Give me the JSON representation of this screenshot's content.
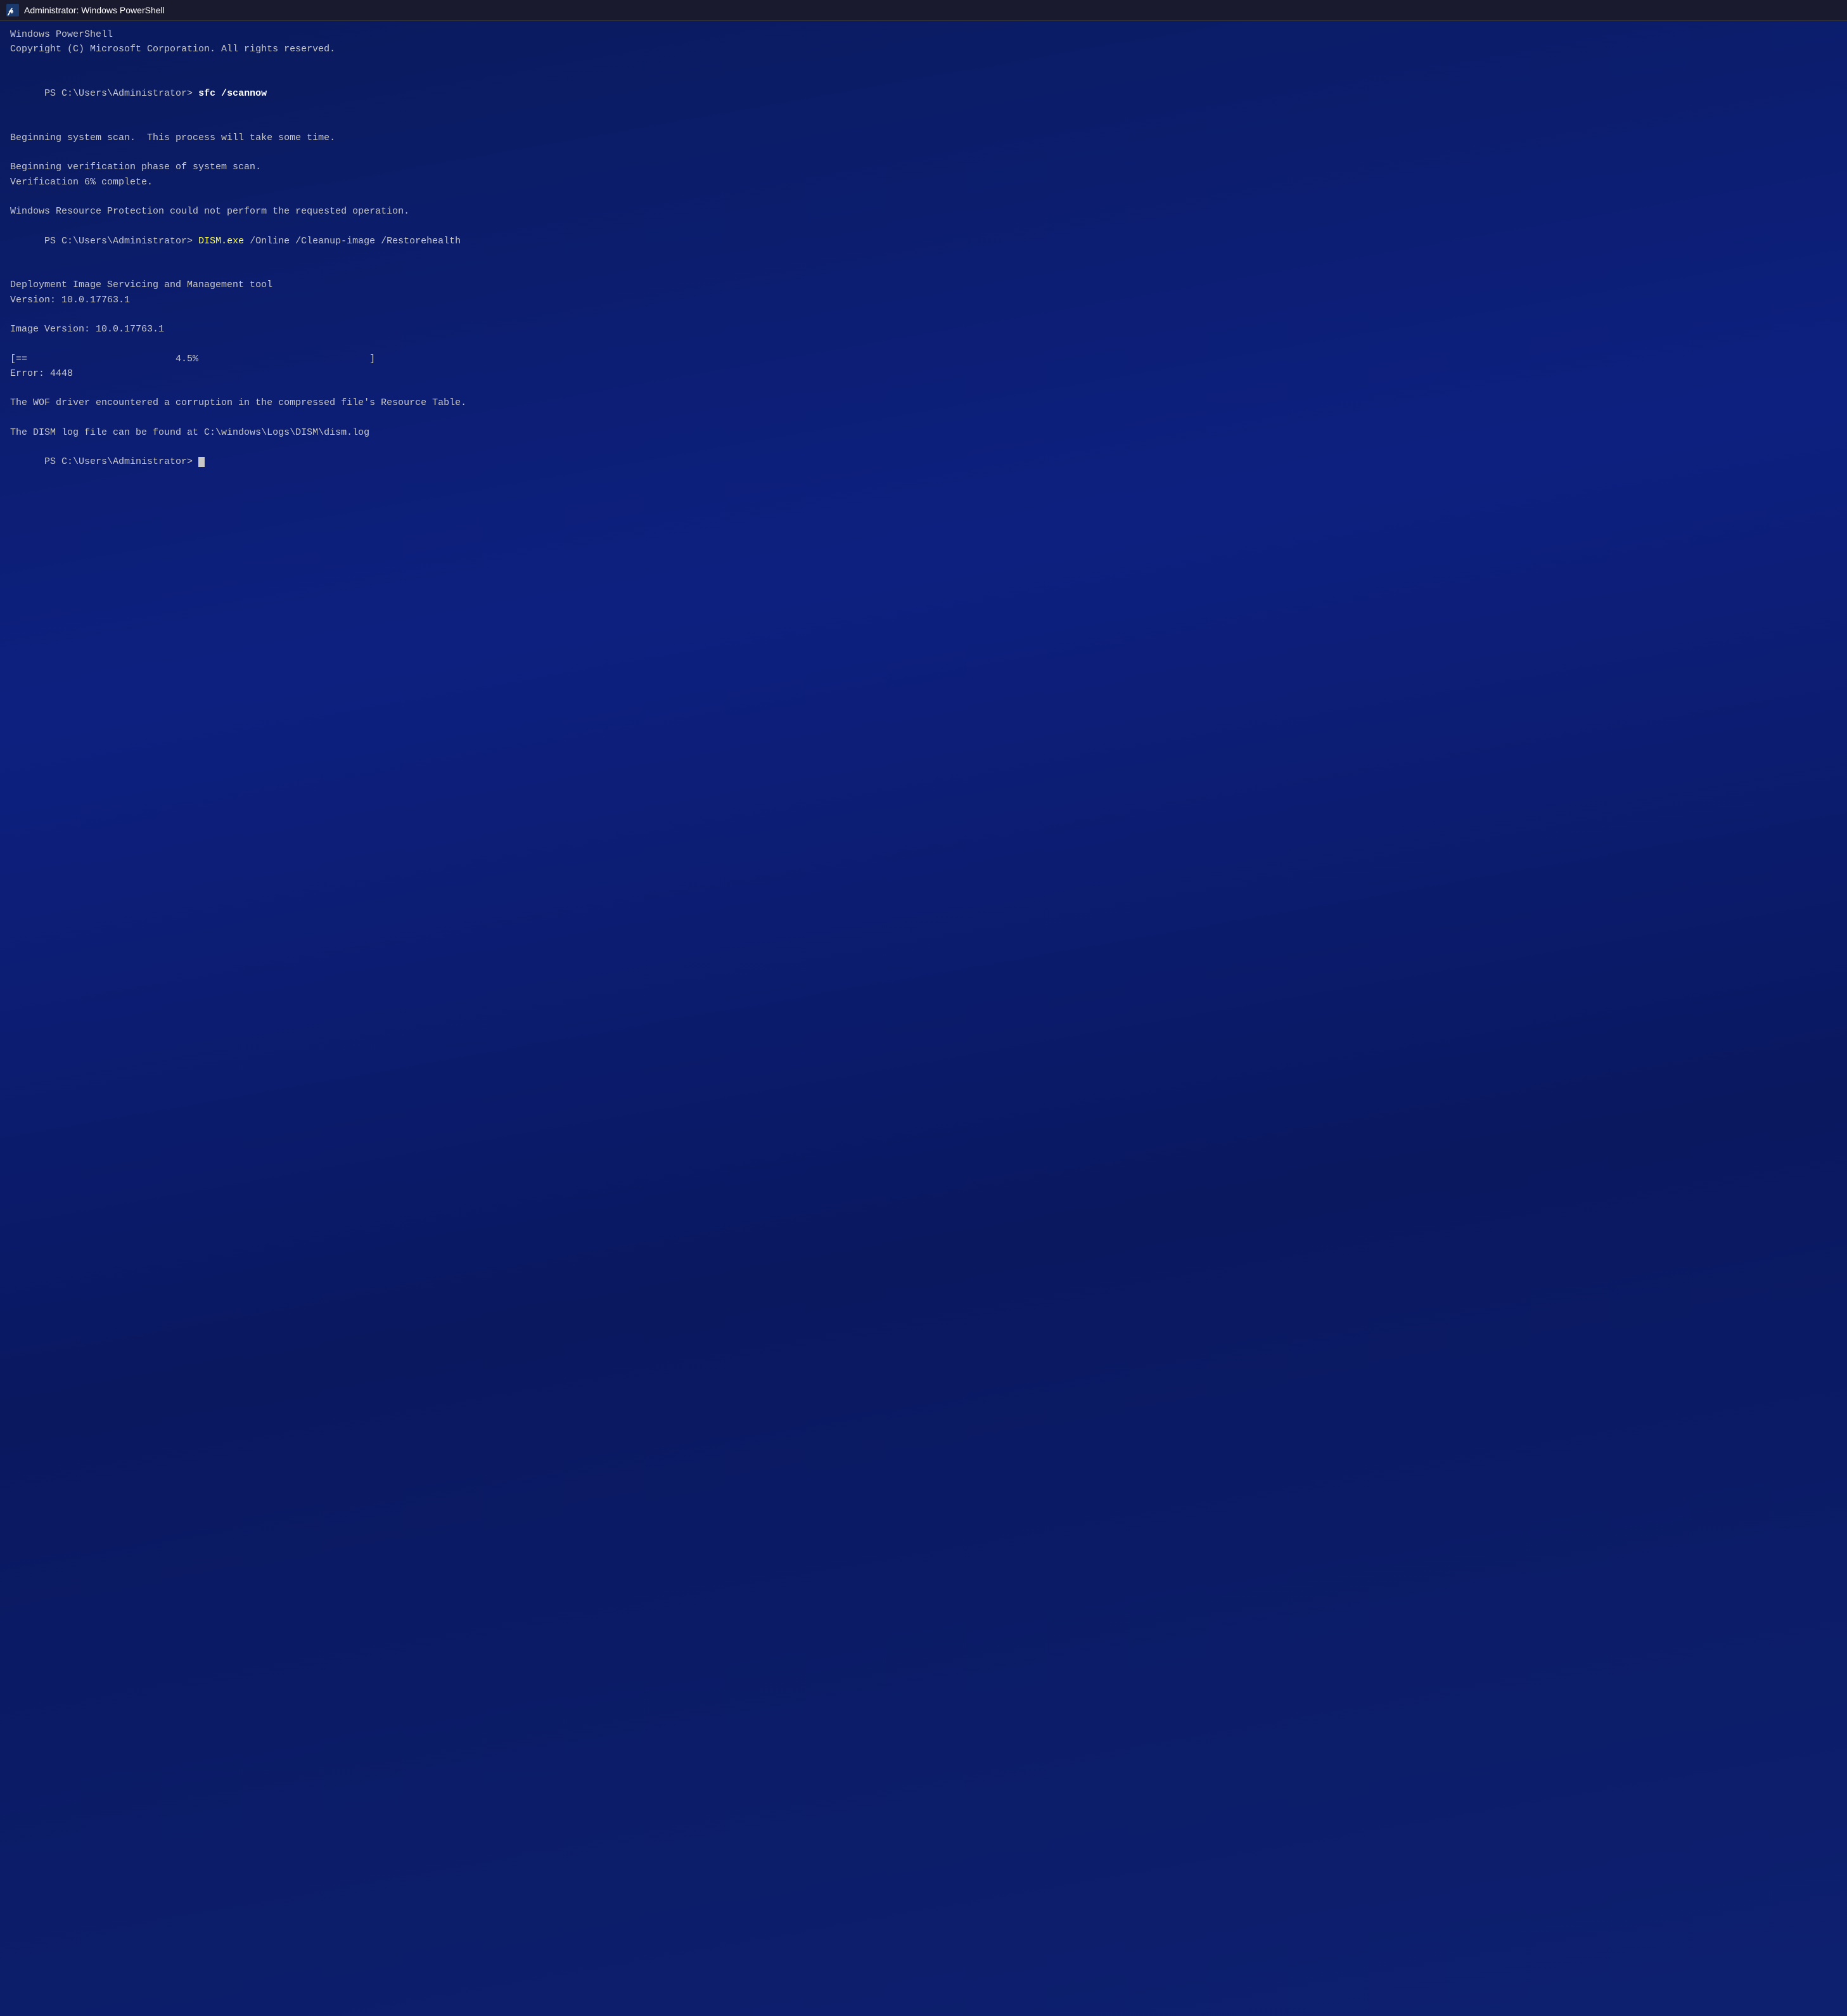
{
  "titlebar": {
    "icon": "powershell-icon",
    "title": "Administrator: Windows PowerShell"
  },
  "terminal": {
    "header_line1": "Windows PowerShell",
    "header_line2": "Copyright (C) Microsoft Corporation. All rights reserved.",
    "prompt1": "PS C:\\Users\\Administrator> ",
    "command1": "sfc /scannow",
    "blank1": "",
    "line1": "Beginning system scan.  This process will take some time.",
    "blank2": "",
    "line2": "Beginning verification phase of system scan.",
    "line3": "Verification 6% complete.",
    "blank3": "",
    "line4": "Windows Resource Protection could not perform the requested operation.",
    "prompt2_before": "PS C:\\Users\\Administrator> ",
    "dism_exe": "DISM.exe",
    "dism_args": " /Online /Cleanup-image /Restorehealth",
    "blank4": "",
    "dism_line1": "Deployment Image Servicing and Management tool",
    "dism_line2": "Version: 10.0.17763.1",
    "blank5": "",
    "image_version": "Image Version: 10.0.17763.1",
    "blank6": "",
    "progress_line": "[==                          4.5%                              ]",
    "error_line": "Error: 4448",
    "blank7": "",
    "wof_error": "The WOF driver encountered a corruption in the compressed file's Resource Table.",
    "blank8": "",
    "dism_log": "The DISM log file can be found at C:\\windows\\Logs\\DISM\\dism.log",
    "prompt_final": "PS C:\\Users\\Administrator> "
  }
}
